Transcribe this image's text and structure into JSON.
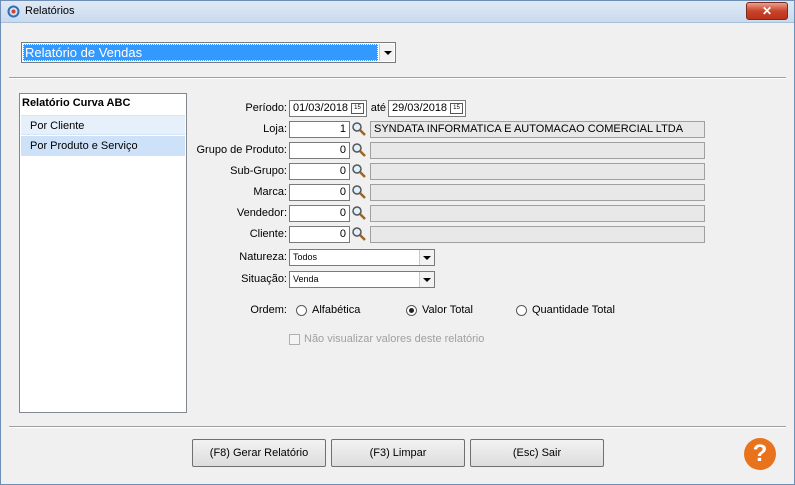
{
  "window": {
    "title": "Relatórios",
    "close_label": "✕"
  },
  "report_select": {
    "value": "Relatório de Vendas"
  },
  "report_list": {
    "header": "Relatório Curva ABC",
    "items": [
      {
        "label": "Por Cliente"
      },
      {
        "label": "Por Produto e Serviço"
      }
    ]
  },
  "form": {
    "periodo": {
      "label": "Período:",
      "from": "01/03/2018",
      "to_label": "até",
      "to": "29/03/2018"
    },
    "loja": {
      "label": "Loja:",
      "value": "1",
      "desc": "SYNDATA INFORMATICA E AUTOMACAO COMERCIAL LTDA"
    },
    "grupo_produto": {
      "label": "Grupo de Produto:",
      "value": "0",
      "desc": ""
    },
    "sub_grupo": {
      "label": "Sub-Grupo:",
      "value": "0",
      "desc": ""
    },
    "marca": {
      "label": "Marca:",
      "value": "0",
      "desc": ""
    },
    "vendedor": {
      "label": "Vendedor:",
      "value": "0",
      "desc": ""
    },
    "cliente": {
      "label": "Cliente:",
      "value": "0",
      "desc": ""
    },
    "natureza": {
      "label": "Natureza:",
      "value": "Todos"
    },
    "situacao": {
      "label": "Situação:",
      "value": "Venda"
    },
    "ordem": {
      "label": "Ordem:",
      "options": [
        "Alfabética",
        "Valor Total",
        "Quantidade Total"
      ],
      "selected": "Valor Total"
    },
    "hide_values": {
      "label": "Não visualizar valores deste relatório",
      "checked": false
    }
  },
  "buttons": {
    "gerar": "(F8) Gerar Relatório",
    "limpar": "(F3) Limpar",
    "sair": "(Esc) Sair"
  },
  "help_label": "?",
  "calendar_icon_text": "15"
}
